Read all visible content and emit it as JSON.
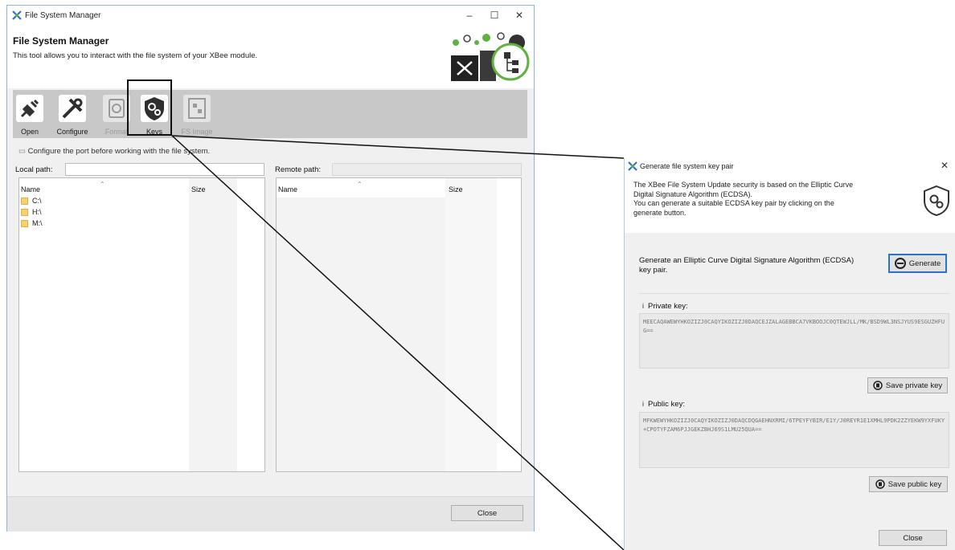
{
  "main_window": {
    "title": "File System Manager",
    "controls": {
      "minimize": "–",
      "maximize": "☐",
      "close": "✕"
    },
    "header_title": "File System Manager",
    "header_desc": "This tool allows you to interact with the file system of your XBee module.",
    "toolbar": [
      {
        "label": "Open",
        "icon": "plug-icon",
        "enabled": true
      },
      {
        "label": "Configure",
        "icon": "tools-icon",
        "enabled": true
      },
      {
        "label": "Format",
        "icon": "format-icon",
        "enabled": false
      },
      {
        "label": "Keys",
        "icon": "shield-gears-icon",
        "enabled": true,
        "highlighted": true
      },
      {
        "label": "FS Image",
        "icon": "fs-image-icon",
        "enabled": false
      }
    ],
    "port_hint": "Configure the port before working with the file system.",
    "local_path_label": "Local path:",
    "local_path_value": "",
    "remote_path_label": "Remote path:",
    "remote_path_value": "",
    "local_columns": {
      "name": "Name",
      "size": "Size"
    },
    "remote_columns": {
      "name": "Name",
      "size": "Size"
    },
    "local_items": [
      "C:\\",
      "H:\\",
      "M:\\"
    ],
    "close_label": "Close"
  },
  "dialog": {
    "title": "Generate file system key pair",
    "close": "✕",
    "desc_lines": [
      "The XBee File System Update security is based on the Elliptic Curve",
      "Digital Signature Algorithm (ECDSA).",
      "You can generate a suitable ECDSA key pair by clicking on the",
      "generate button."
    ],
    "generate_text_lines": [
      "Generate an Elliptic Curve Digital Signature Algorithm (ECDSA)",
      "key pair."
    ],
    "generate_label": "Generate",
    "private_key_label": "Private key:",
    "private_key_value": "MEECAQAWEWYHKOZIZJ0CAQYIKOZIZJ0DAQCEJZALAGEBBCA7VKBOOJC0QTEWJLL/MK/BSD9WL3NSJYUS9ESGUZHFUG==",
    "save_private_label": "Save private key",
    "public_key_label": "Public key:",
    "public_key_value": "MFKWEWYHKOZIZJ0CAQYIKOZIZJ0DAQCDQGAEHNXRMI/6TPEYFYBIR/E1Y/J0REYR1E1XMHL9PDK2ZZYEKW9YXFUKY+CPOTYFZAM6PJJGEKZBHJ69S1LMU25QUA==",
    "save_public_label": "Save public key",
    "close_label": "Close"
  },
  "colors": {
    "accent": "#2b72c8",
    "toolbar_bg": "#c8c8c8",
    "green": "#5fb23f"
  }
}
